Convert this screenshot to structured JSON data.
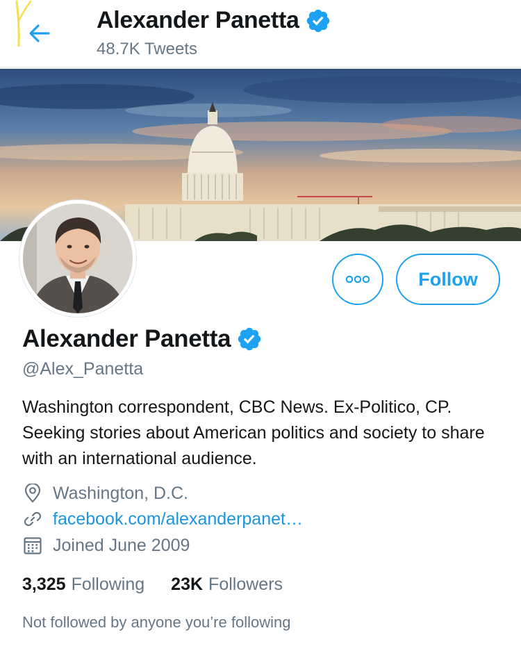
{
  "header": {
    "name": "Alexander Panetta",
    "tweet_count": "48.7K Tweets"
  },
  "profile": {
    "name": "Alexander Panetta",
    "handle": "@Alex_Panetta",
    "bio": "Washington correspondent, CBC News. Ex-Politico, CP. Seeking stories about American politics and society to share with an international audience.",
    "location": "Washington, D.C.",
    "website": "facebook.com/alexanderpanet…",
    "joined": "Joined June 2009",
    "verified": true
  },
  "actions": {
    "follow_label": "Follow",
    "more_label": "More"
  },
  "stats": {
    "following_count": "3,325",
    "following_label": "Following",
    "followers_count": "23K",
    "followers_label": "Followers"
  },
  "social_context": "Not followed by anyone you’re following",
  "icons": {
    "back": "back-arrow-icon",
    "verified": "verified-badge-icon",
    "more": "more-dots-icon",
    "location": "location-pin-icon",
    "link": "link-icon",
    "calendar": "calendar-icon"
  },
  "colors": {
    "accent": "#1da1f2",
    "link": "#1b95e0",
    "secondary_text": "#657786",
    "primary_text": "#14171a",
    "highlight_mark": "#f4e04d"
  }
}
